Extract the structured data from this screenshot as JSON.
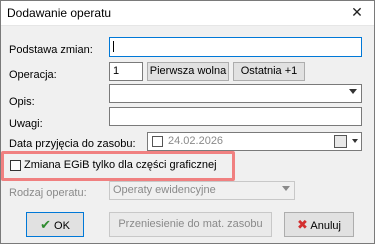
{
  "window": {
    "title": "Dodawanie operatu"
  },
  "form": {
    "podstawa_label": "Podstawa zmian:",
    "operacja_label": "Operacja:",
    "operacja_value": "1",
    "pierwsza_wolna": "Pierwsza wolna",
    "ostatnia_plus1": "Ostatnia +1",
    "opis_label": "Opis:",
    "uwagi_label": "Uwagi:",
    "data_label": "Data przyjęcia do zasobu:",
    "date_value": "24.02.2026",
    "egib_label": "Zmiana EGiB tylko dla części graficznej",
    "rodzaj_label": "Rodzaj operatu:",
    "rodzaj_value": "Operaty ewidencyjne"
  },
  "buttons": {
    "ok": "OK",
    "przeniesienie": "Przeniesienie do mat. zasobu",
    "anuluj": "Anuluj"
  },
  "colors": {
    "highlight": "#f08080",
    "accent": "#0078d7",
    "ok_check": "#2e8b2e",
    "cancel_x": "#d32f2f"
  }
}
